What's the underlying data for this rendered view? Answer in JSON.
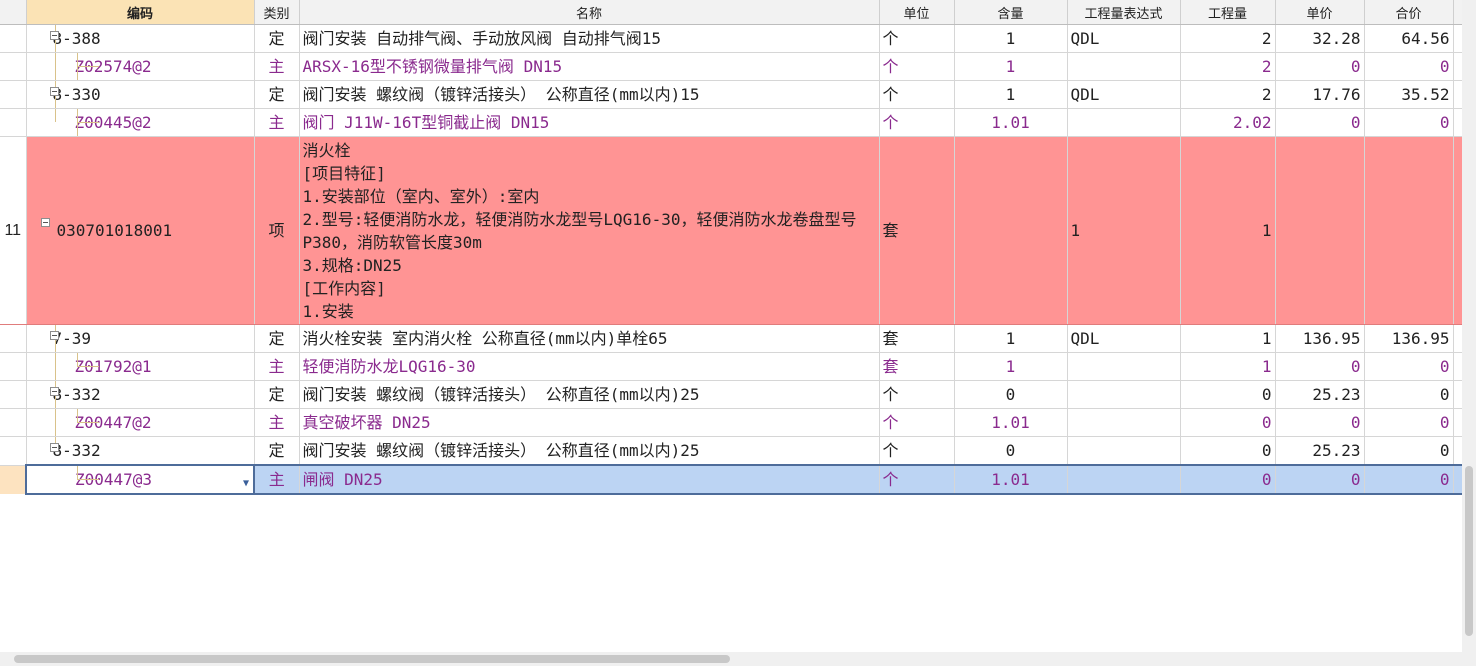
{
  "headers": {
    "code": "编码",
    "type": "类别",
    "name": "名称",
    "unit": "单位",
    "content": "含量",
    "expr": "工程量表达式",
    "qty": "工程量",
    "price": "单价",
    "total": "合价"
  },
  "rows": [
    {
      "idx": "",
      "code": "8-388",
      "type": "定",
      "name": "阀门安装 自动排气阀、手动放风阀 自动排气阀15",
      "unit": "个",
      "content": "1",
      "expr": "QDL",
      "qty": "2",
      "price": "32.28",
      "total": "64.56"
    },
    {
      "idx": "",
      "code": "Z02574@2",
      "type": "主",
      "name": "ARSX-16型不锈钢微量排气阀 DN15",
      "unit": "个",
      "content": "1",
      "expr": "",
      "qty": "2",
      "price": "0",
      "total": "0"
    },
    {
      "idx": "",
      "code": "8-330",
      "type": "定",
      "name": "阀门安装 螺纹阀（镀锌活接头） 公称直径(mm以内)15",
      "unit": "个",
      "content": "1",
      "expr": "QDL",
      "qty": "2",
      "price": "17.76",
      "total": "35.52"
    },
    {
      "idx": "",
      "code": "Z00445@2",
      "type": "主",
      "name": "阀门 J11W-16T型铜截止阀 DN15",
      "unit": "个",
      "content": "1.01",
      "expr": "",
      "qty": "2.02",
      "price": "0",
      "total": "0"
    },
    {
      "idx": "11",
      "code": "030701018001",
      "type": "项",
      "name_lines": [
        "消火栓",
        "[项目特征]",
        "1.安装部位（室内、室外）:室内",
        "2.型号:轻便消防水龙，轻便消防水龙型号LQG16-30，轻便消防水龙卷盘型号P380，消防软管长度30m",
        "3.规格:DN25",
        "[工作内容]",
        "1.安装"
      ],
      "unit": "套",
      "content": "",
      "expr": "1",
      "qty": "1",
      "price": "",
      "total": ""
    },
    {
      "idx": "",
      "code": "7-39",
      "type": "定",
      "name": "消火栓安装 室内消火栓 公称直径(mm以内)单栓65",
      "unit": "套",
      "content": "1",
      "expr": "QDL",
      "qty": "1",
      "price": "136.95",
      "total": "136.95"
    },
    {
      "idx": "",
      "code": "Z01792@1",
      "type": "主",
      "name": "轻便消防水龙LQG16-30",
      "unit": "套",
      "content": "1",
      "expr": "",
      "qty": "1",
      "price": "0",
      "total": "0"
    },
    {
      "idx": "",
      "code": "8-332",
      "type": "定",
      "name": "阀门安装 螺纹阀（镀锌活接头） 公称直径(mm以内)25",
      "unit": "个",
      "content": "0",
      "expr": "",
      "qty": "0",
      "price": "25.23",
      "total": "0"
    },
    {
      "idx": "",
      "code": "Z00447@2",
      "type": "主",
      "name": "真空破坏器 DN25",
      "unit": "个",
      "content": "1.01",
      "expr": "",
      "qty": "0",
      "price": "0",
      "total": "0"
    },
    {
      "idx": "",
      "code": "8-332",
      "type": "定",
      "name": "阀门安装 螺纹阀（镀锌活接头） 公称直径(mm以内)25",
      "unit": "个",
      "content": "0",
      "expr": "",
      "qty": "0",
      "price": "25.23",
      "total": "0"
    },
    {
      "idx": "",
      "code": "Z00447@3",
      "type": "主",
      "name": "闸阀 DN25",
      "unit": "个",
      "content": "1.01",
      "expr": "",
      "qty": "0",
      "price": "0",
      "total": "0"
    }
  ],
  "icons": {
    "expand": "collapse-toggle-icon",
    "dropdown": "dropdown-arrow-icon"
  }
}
